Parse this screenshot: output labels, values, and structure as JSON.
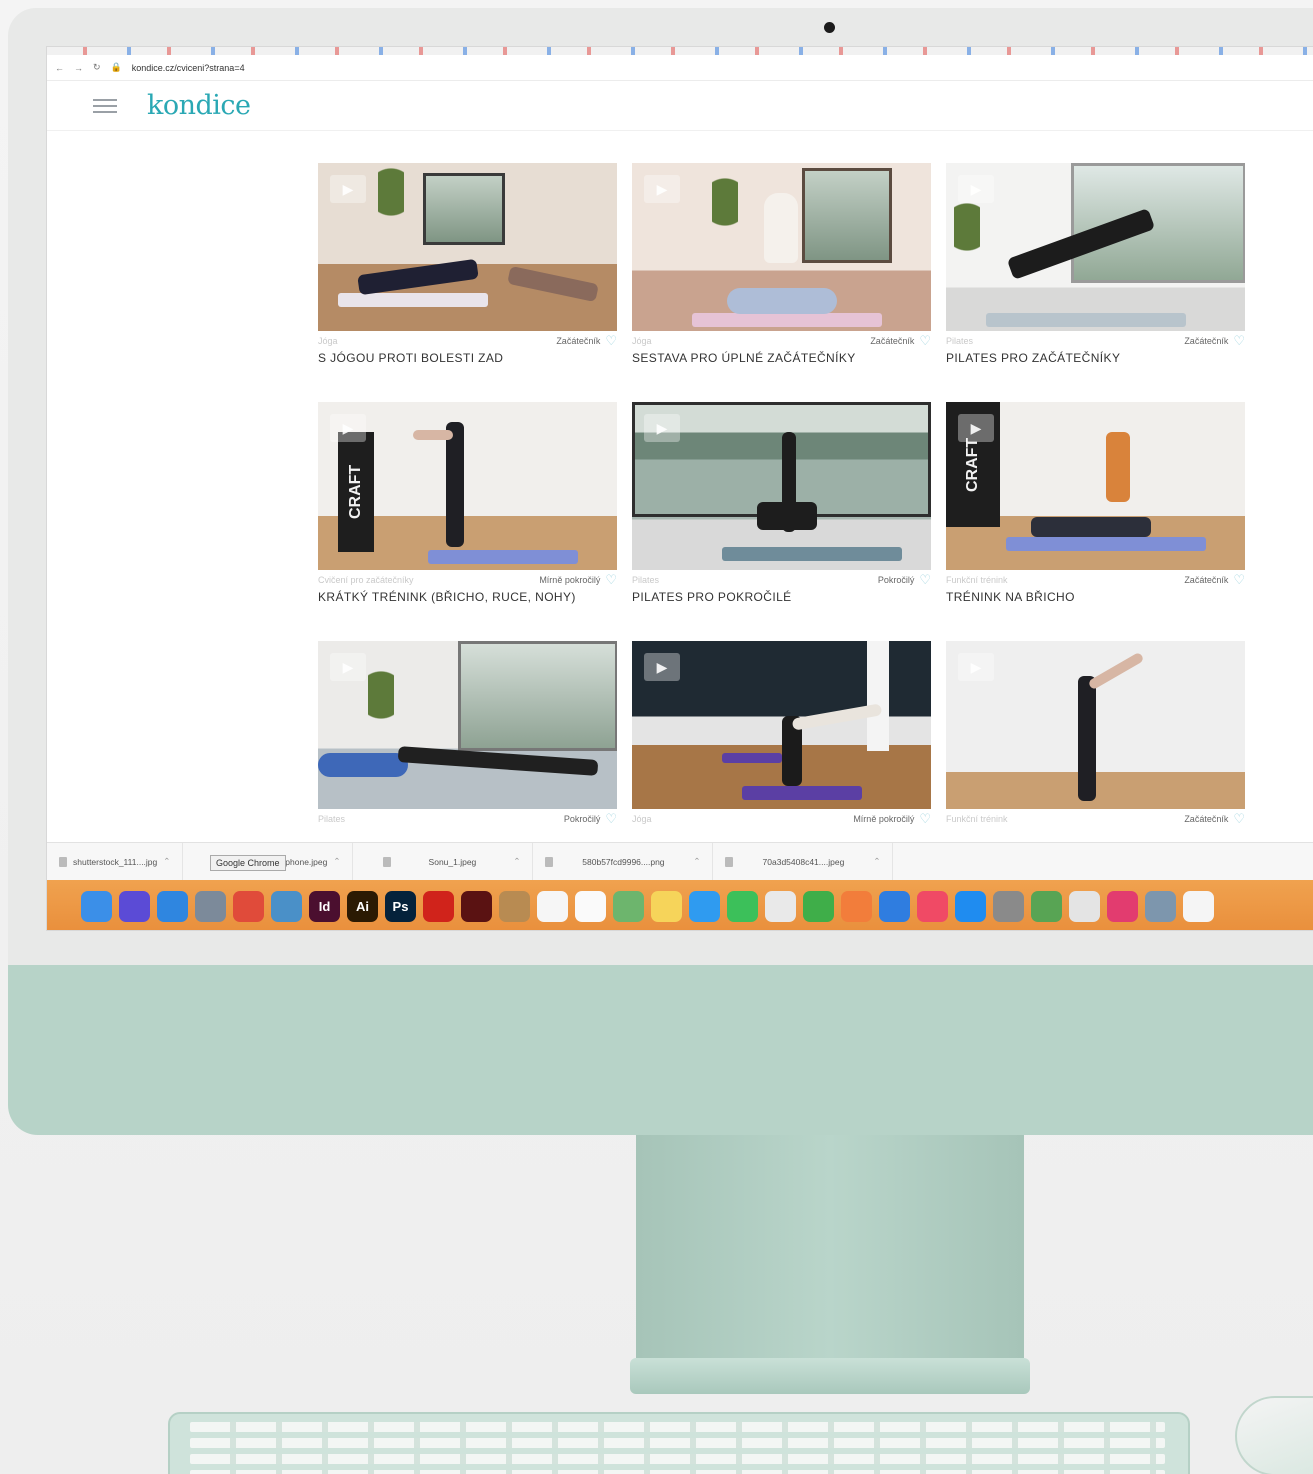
{
  "browser": {
    "url": "kondice.cz/cviceni?strana=4"
  },
  "site": {
    "logo": "kondice"
  },
  "cards": [
    {
      "category": "Jóga",
      "level": "Začátečník",
      "title": "S JÓGOU PROTI BOLESTI ZAD"
    },
    {
      "category": "Jóga",
      "level": "Začátečník",
      "title": "SESTAVA PRO ÚPLNÉ ZAČÁTEČNÍKY"
    },
    {
      "category": "Pilates",
      "level": "Začátečník",
      "title": "PILATES PRO ZAČÁTEČNÍKY"
    },
    {
      "category": "Cvičení pro začátečníky",
      "level": "Mírně pokročilý",
      "title": "KRÁTKÝ TRÉNINK (BŘICHO, RUCE, NOHY)"
    },
    {
      "category": "Pilates",
      "level": "Pokročilý",
      "title": "PILATES PRO POKROČILÉ"
    },
    {
      "category": "Funkční trénink",
      "level": "Začátečník",
      "title": "TRÉNINK NA BŘICHO"
    },
    {
      "category": "Pilates",
      "level": "Pokročilý",
      "title": ""
    },
    {
      "category": "Jóga",
      "level": "Mírně pokročilý",
      "title": ""
    },
    {
      "category": "Funkční trénink",
      "level": "Začátečník",
      "title": ""
    }
  ],
  "downloads": {
    "tooltip": "Google Chrome",
    "items": [
      "shutterstock_111....jpg",
      "iphone.jpeg",
      "Sonu_1.jpeg",
      "580b57fcd9996....png",
      "70a3d5408c41....jpeg"
    ]
  },
  "banner_text": "CRAFT",
  "dock": {
    "icons": [
      {
        "name": "finder-icon",
        "label": "",
        "color": "#3b8fe8"
      },
      {
        "name": "siri-icon",
        "label": "",
        "color": "#5b4bd6"
      },
      {
        "name": "safari-icon",
        "label": "",
        "color": "#2f86e0"
      },
      {
        "name": "launchpad-icon",
        "label": "",
        "color": "#7c8a9a"
      },
      {
        "name": "chrome-icon",
        "label": "",
        "color": "#e04b3a"
      },
      {
        "name": "preview-icon",
        "label": "",
        "color": "#4a90c8"
      },
      {
        "name": "indesign-icon",
        "label": "Id",
        "color": "#4b0f2f"
      },
      {
        "name": "illustrator-icon",
        "label": "Ai",
        "color": "#2b1a03"
      },
      {
        "name": "photoshop-icon",
        "label": "Ps",
        "color": "#05223b"
      },
      {
        "name": "acrobat-icon",
        "label": "",
        "color": "#d0231b"
      },
      {
        "name": "acrobat-dc-icon",
        "label": "",
        "color": "#5a1212"
      },
      {
        "name": "folder-icon",
        "label": "",
        "color": "#b88b52"
      },
      {
        "name": "calendar-icon",
        "label": "",
        "color": "#f6f6f6"
      },
      {
        "name": "reminders-icon",
        "label": "",
        "color": "#fafafa"
      },
      {
        "name": "maps-icon",
        "label": "",
        "color": "#6db56d"
      },
      {
        "name": "notes-icon",
        "label": "",
        "color": "#f6d45a"
      },
      {
        "name": "messages-icon",
        "label": "",
        "color": "#2f9bf0"
      },
      {
        "name": "facetime-icon",
        "label": "",
        "color": "#3cc05a"
      },
      {
        "name": "textedit-icon",
        "label": "",
        "color": "#e9e9e9"
      },
      {
        "name": "numbers-icon",
        "label": "",
        "color": "#3fae49"
      },
      {
        "name": "photos-icon",
        "label": "",
        "color": "#f27d3b"
      },
      {
        "name": "keynote-icon",
        "label": "",
        "color": "#2f7de0"
      },
      {
        "name": "music-icon",
        "label": "",
        "color": "#f04a65"
      },
      {
        "name": "appstore-icon",
        "label": "",
        "color": "#1f8cf0"
      },
      {
        "name": "settings-icon",
        "label": "",
        "color": "#8a8a8a"
      },
      {
        "name": "network-icon",
        "label": "",
        "color": "#58a454"
      },
      {
        "name": "preview-doc-icon",
        "label": "",
        "color": "#e4e4e4"
      },
      {
        "name": "creative-cloud-icon",
        "label": "",
        "color": "#e23c6f"
      },
      {
        "name": "image-capture-icon",
        "label": "",
        "color": "#7d96ad"
      },
      {
        "name": "downloads-stack-icon",
        "label": "",
        "color": "#f5f5f5"
      }
    ]
  }
}
